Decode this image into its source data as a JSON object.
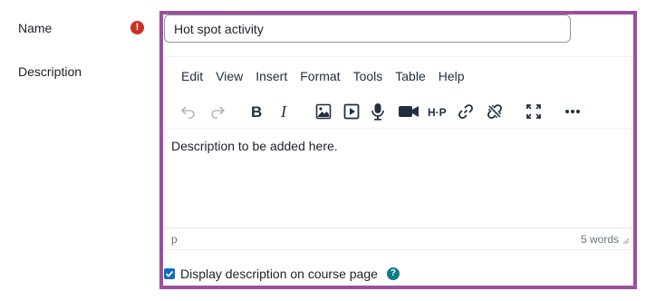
{
  "form": {
    "name_label": "Name",
    "description_label": "Description",
    "name_value": "Hot spot activity",
    "required_symbol": "!"
  },
  "editor": {
    "menus": [
      "Edit",
      "View",
      "Insert",
      "Format",
      "Tools",
      "Table",
      "Help"
    ],
    "toolbar_icons": [
      "undo-icon",
      "redo-icon",
      "bold-icon",
      "italic-icon",
      "image-icon",
      "media-icon",
      "record-audio-icon",
      "record-video-icon",
      "h5p-icon",
      "link-icon",
      "unlink-icon",
      "fullscreen-icon",
      "more-icon"
    ],
    "h5p_text": "H·P",
    "content_text": "Description to be added here.",
    "status_path": "p",
    "word_count": "5 words"
  },
  "display_option": {
    "label": "Display description on course page",
    "checked": true,
    "help_symbol": "?"
  },
  "colors": {
    "highlight_frame": "#9b4fa0",
    "required": "#ca3120",
    "checkbox": "#0f6cbf",
    "help": "#0f7a8a"
  }
}
